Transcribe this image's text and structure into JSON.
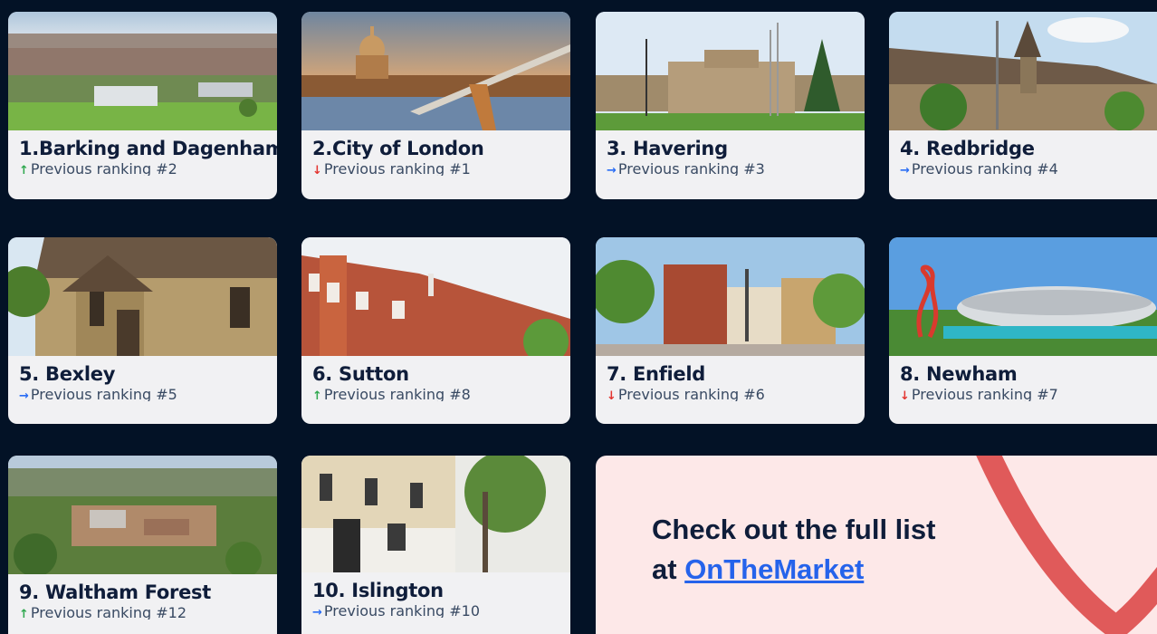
{
  "colors": {
    "background": "#031226",
    "up": "#2fa84f",
    "down": "#e3342f",
    "same": "#2a6df4",
    "link": "#2563eb",
    "promo_bg": "#fde8e8",
    "heart": "#e05a5a"
  },
  "cards": [
    {
      "title": "1.Barking and Dagenham",
      "arrow": "↑",
      "trend": "up",
      "prev": "Previous ranking #2",
      "icon": "aerial-suburb-photo"
    },
    {
      "title": "2.City of London",
      "arrow": "↓",
      "trend": "down",
      "prev": "Previous ranking #1",
      "icon": "st-pauls-bridge-photo"
    },
    {
      "title": "3. Havering",
      "arrow": "→",
      "trend": "same",
      "prev": "Previous ranking #3",
      "icon": "town-hall-photo"
    },
    {
      "title": "4. Redbridge",
      "arrow": "→",
      "trend": "same",
      "prev": "Previous ranking #4",
      "icon": "stone-church-photo"
    },
    {
      "title": "5. Bexley",
      "arrow": "→",
      "trend": "same",
      "prev": "Previous ranking #5",
      "icon": "old-church-photo"
    },
    {
      "title": "6. Sutton",
      "arrow": "↑",
      "trend": "up",
      "prev": "Previous ranking #8",
      "icon": "red-brick-buildings-photo"
    },
    {
      "title": "7. Enfield",
      "arrow": "↓",
      "trend": "down",
      "prev": "Previous ranking #6",
      "icon": "town-square-photo"
    },
    {
      "title": "8. Newham",
      "arrow": "↓",
      "trend": "down",
      "prev": "Previous ranking #7",
      "icon": "olympic-stadium-photo"
    },
    {
      "title": "9. Waltham Forest",
      "arrow": "↑",
      "trend": "up",
      "prev": "Previous ranking #12",
      "icon": "aerial-town-photo"
    },
    {
      "title": "10. Islington",
      "arrow": "→",
      "trend": "same",
      "prev": "Previous ranking #10",
      "icon": "georgian-terrace-photo"
    }
  ],
  "promo": {
    "line1": "Check out the full list",
    "line2_prefix": "at ",
    "link_text": "OnTheMarket"
  }
}
